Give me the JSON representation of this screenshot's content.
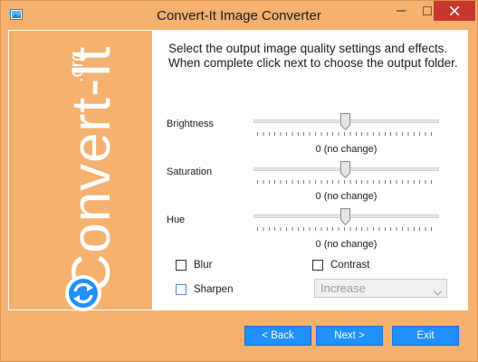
{
  "window": {
    "title": "Convert-It Image Converter",
    "accent_color": "#f4b16f",
    "close_color": "#c7372f",
    "icons": {
      "app": "picture-icon",
      "minimize": "minimize-icon",
      "maximize": "maximize-icon",
      "close": "close-icon"
    }
  },
  "brand": {
    "name": "Convert-It",
    "domain": ".org",
    "logo_icon": "refresh-arrows-icon"
  },
  "instructions": "Select the output image quality settings and effects. When complete click next to choose the output folder.",
  "sliders": [
    {
      "label": "Brightness",
      "value_text": "0 (no change)",
      "value": 0
    },
    {
      "label": "Saturation",
      "value_text": "0 (no change)",
      "value": 0
    },
    {
      "label": "Hue",
      "value_text": "0 (no change)",
      "value": 0
    }
  ],
  "options": {
    "blur": {
      "label": "Blur",
      "checked": false
    },
    "contrast": {
      "label": "Contrast",
      "checked": false
    },
    "sharpen": {
      "label": "Sharpen",
      "checked": false
    },
    "sharpen_mode": {
      "selected": "Increase",
      "disabled": true
    }
  },
  "buttons": {
    "back": "< Back",
    "next": "Next >",
    "exit": "Exit",
    "color": "#1e90ff"
  }
}
